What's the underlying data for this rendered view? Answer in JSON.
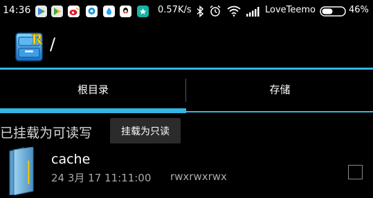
{
  "status_bar": {
    "time": "14:36",
    "network_speed": "0.57K/s",
    "carrier": "LoveTeemo",
    "battery_percent": "46%",
    "notification_icons": [
      "play-store-icon",
      "play-store-icon",
      "weibo-icon",
      "chat-icon",
      "app-store-icon",
      "qq-icon",
      "app-icon"
    ]
  },
  "app_bar": {
    "current_path": "/",
    "logo_icon": "root-explorer-logo-icon"
  },
  "tabs": [
    {
      "label": "根目录",
      "active": true
    },
    {
      "label": "存储",
      "active": false
    }
  ],
  "mount": {
    "status_text": "已挂载为可读写",
    "button_label": "挂载为只读"
  },
  "files": [
    {
      "name": "cache",
      "date": "24 3月 17 11:11:00",
      "permissions": "rwxrwxrwx",
      "icon": "folder-icon"
    }
  ],
  "colors": {
    "accent": "#33b5e5",
    "background": "#000000"
  }
}
